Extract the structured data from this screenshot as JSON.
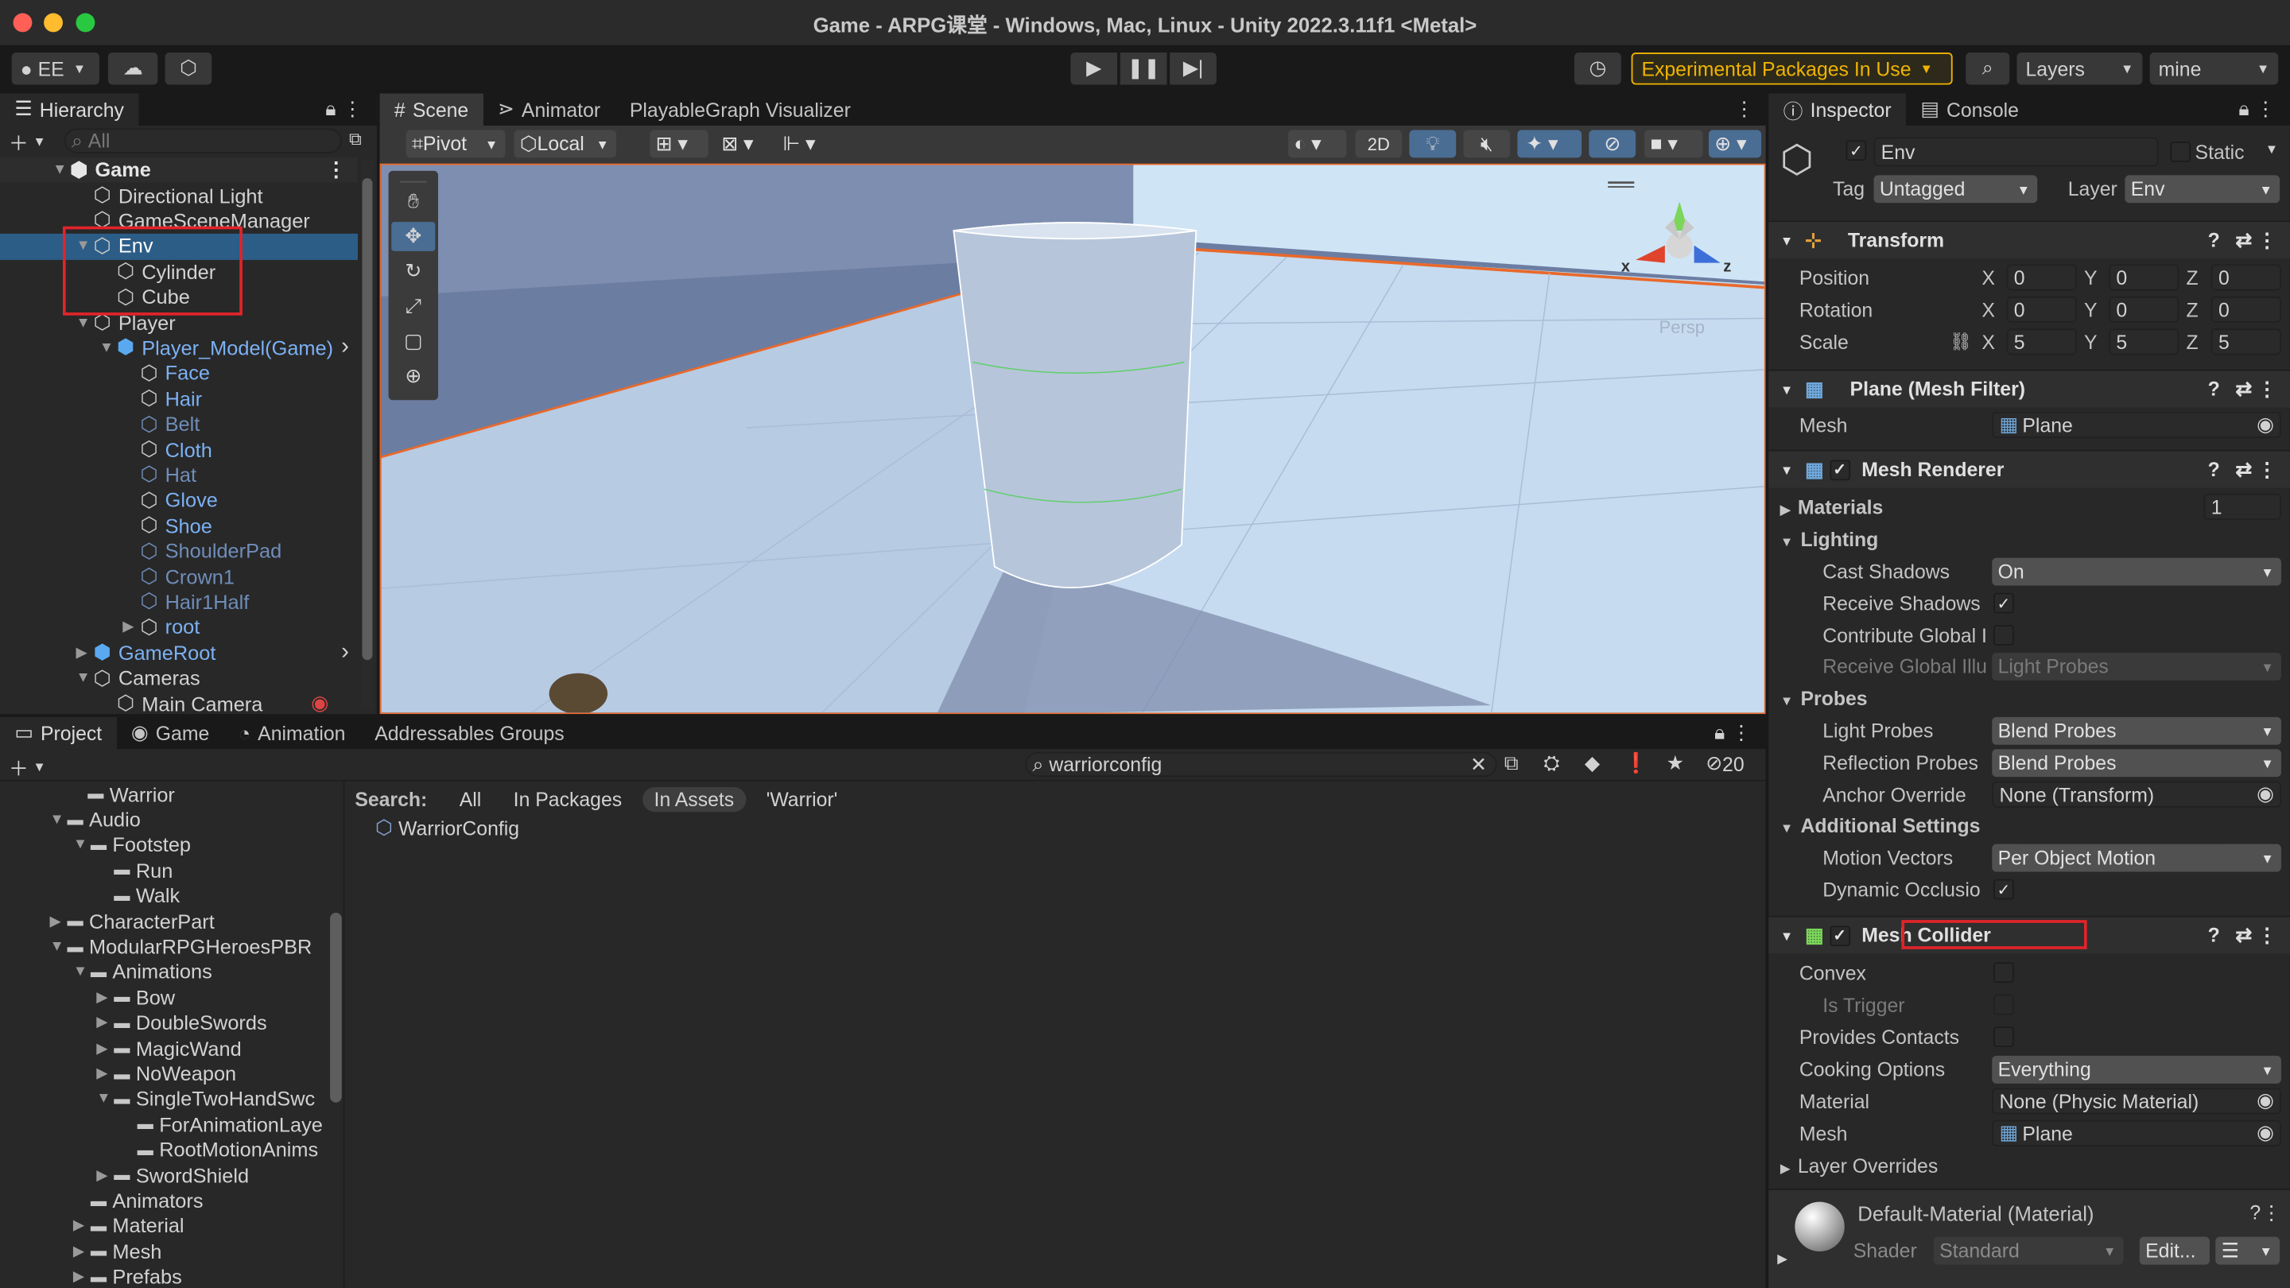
{
  "window": {
    "title": "Game - ARPG课堂 - Windows, Mac, Linux - Unity 2022.3.11f1 <Metal>"
  },
  "toolbar": {
    "account": "EE",
    "experimental": "Experimental Packages In Use",
    "layers": "Layers",
    "layout": "mine"
  },
  "hierarchy": {
    "tab": "Hierarchy",
    "search_placeholder": "All",
    "root": "Game",
    "items": [
      {
        "label": "Directional Light"
      },
      {
        "label": "GameSceneManager"
      },
      {
        "label": "Env"
      },
      {
        "label": "Cylinder"
      },
      {
        "label": "Cube"
      },
      {
        "label": "Player"
      },
      {
        "label": "Player_Model(Game)"
      },
      {
        "label": "Face"
      },
      {
        "label": "Hair"
      },
      {
        "label": "Belt"
      },
      {
        "label": "Cloth"
      },
      {
        "label": "Hat"
      },
      {
        "label": "Glove"
      },
      {
        "label": "Shoe"
      },
      {
        "label": "ShoulderPad"
      },
      {
        "label": "Crown1"
      },
      {
        "label": "Hair1Half"
      },
      {
        "label": "root"
      },
      {
        "label": "GameRoot"
      },
      {
        "label": "Cameras"
      },
      {
        "label": "Main Camera"
      }
    ]
  },
  "scene": {
    "tabs": [
      "Scene",
      "Animator",
      "PlayableGraph Visualizer"
    ],
    "pivot": "Pivot",
    "local": "Local",
    "mode2d": "2D",
    "persp": "Persp",
    "gizmo_x": "x",
    "gizmo_z": "z"
  },
  "project": {
    "tabs": [
      "Project",
      "Game",
      "Animation",
      "Addressables Groups"
    ],
    "search_value": "warriorconfig",
    "count": "20",
    "search_label": "Search:",
    "filters": [
      "All",
      "In Packages",
      "In Assets",
      "'Warrior'"
    ],
    "result": "WarriorConfig",
    "folders": [
      {
        "label": "Warrior"
      },
      {
        "label": "Audio"
      },
      {
        "label": "Footstep"
      },
      {
        "label": "Run"
      },
      {
        "label": "Walk"
      },
      {
        "label": "CharacterPart"
      },
      {
        "label": "ModularRPGHeroesPBR"
      },
      {
        "label": "Animations"
      },
      {
        "label": "Bow"
      },
      {
        "label": "DoubleSwords"
      },
      {
        "label": "MagicWand"
      },
      {
        "label": "NoWeapon"
      },
      {
        "label": "SingleTwoHandSwc"
      },
      {
        "label": "ForAnimationLaye"
      },
      {
        "label": "RootMotionAnims"
      },
      {
        "label": "SwordShield"
      },
      {
        "label": "Animators"
      },
      {
        "label": "Material"
      },
      {
        "label": "Mesh"
      },
      {
        "label": "Prefabs"
      }
    ]
  },
  "inspector": {
    "tabs": [
      "Inspector",
      "Console"
    ],
    "object_name": "Env",
    "static_label": "Static",
    "tag_label": "Tag",
    "tag": "Untagged",
    "layer_label": "Layer",
    "layer": "Env",
    "transform": {
      "title": "Transform",
      "position_label": "Position",
      "rotation_label": "Rotation",
      "scale_label": "Scale",
      "position": [
        "0",
        "0",
        "0"
      ],
      "rotation": [
        "0",
        "0",
        "0"
      ],
      "scale": [
        "5",
        "5",
        "5"
      ]
    },
    "axes": [
      "X",
      "Y",
      "Z"
    ],
    "mesh_filter": {
      "title": "Plane (Mesh Filter)",
      "mesh_label": "Mesh",
      "mesh": "Plane"
    },
    "mesh_renderer": {
      "title": "Mesh Renderer",
      "materials_label": "Materials",
      "materials_count": "1",
      "lighting": "Lighting",
      "cast_shadows_label": "Cast Shadows",
      "cast_shadows": "On",
      "receive_shadows_label": "Receive Shadows",
      "contribute_gi_label": "Contribute Global I",
      "receive_gi_label": "Receive Global Illu",
      "receive_gi": "Light Probes",
      "probes": "Probes",
      "light_probes_label": "Light Probes",
      "light_probes": "Blend Probes",
      "reflection_probes_label": "Reflection Probes",
      "reflection_probes": "Blend Probes",
      "anchor_override_label": "Anchor Override",
      "anchor_override": "None (Transform)",
      "additional": "Additional Settings",
      "motion_vectors_label": "Motion Vectors",
      "motion_vectors": "Per Object Motion",
      "dynamic_occlusion_label": "Dynamic Occlusio"
    },
    "mesh_collider": {
      "title": "Mesh Collider",
      "convex_label": "Convex",
      "is_trigger_label": "Is Trigger",
      "provides_contacts_label": "Provides Contacts",
      "cooking_label": "Cooking Options",
      "cooking": "Everything",
      "material_label": "Material",
      "material": "None (Physic Material)",
      "mesh_label": "Mesh",
      "mesh": "Plane",
      "layer_overrides": "Layer Overrides"
    },
    "material": {
      "name": "Default-Material (Material)",
      "shader_label": "Shader",
      "shader": "Standard",
      "edit": "Edit..."
    }
  },
  "colors": {
    "selection": "#2c5d87",
    "accent_warning": "#f0b400",
    "highlight_box": "#e0242a"
  }
}
